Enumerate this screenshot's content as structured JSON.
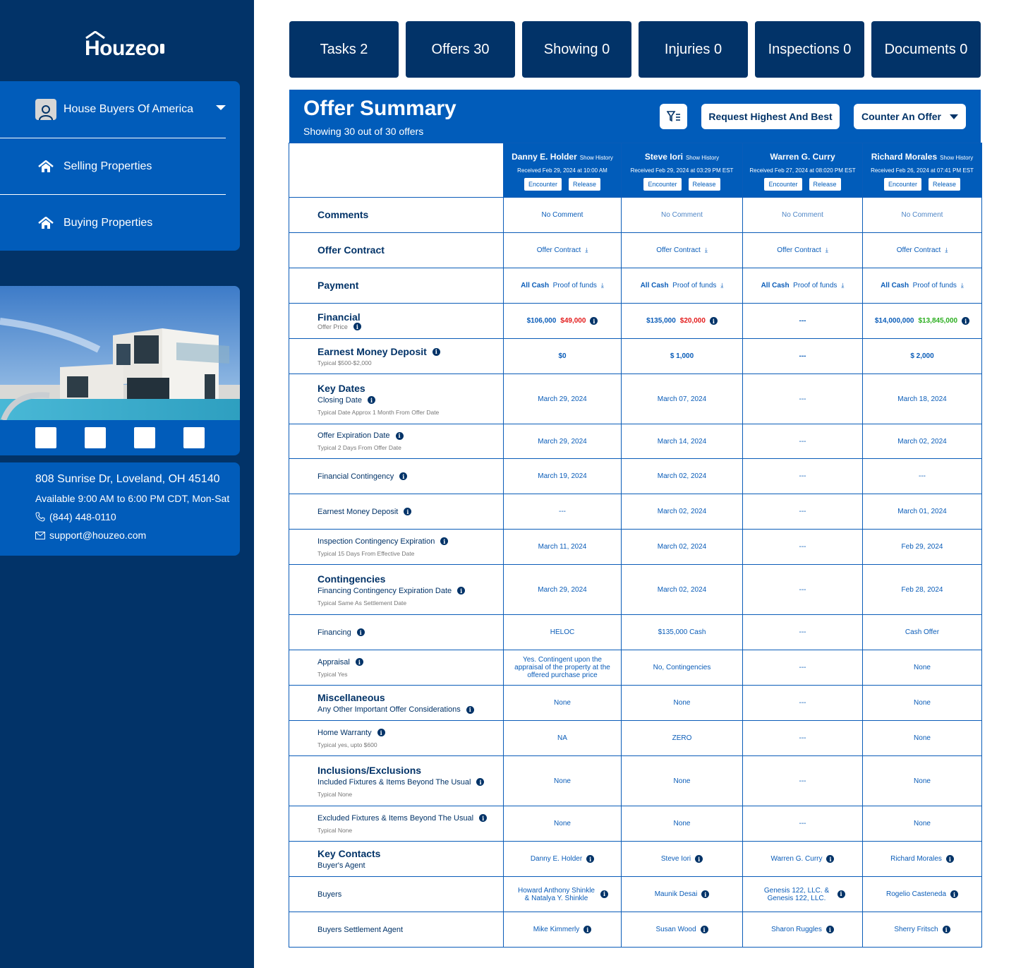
{
  "brand": {
    "name": "Houzeo"
  },
  "sidebar": {
    "account": {
      "name": "House Buyers Of America",
      "icon": "user-icon"
    },
    "nav": [
      {
        "label": "Selling Properties",
        "icon": "home-icon"
      },
      {
        "label": "Buying Properties",
        "icon": "home-icon"
      }
    ],
    "contact": {
      "address": "808 Sunrise Dr, Loveland, OH 45140",
      "hours": "Available 9:00 AM to 6:00 PM CDT, Mon-Sat",
      "phone": "(844) 448-0110",
      "email": "support@houzeo.com"
    }
  },
  "tabs": [
    {
      "label": "Tasks 2"
    },
    {
      "label": "Offers 30"
    },
    {
      "label": "Showing 0"
    },
    {
      "label": "Injuries 0"
    },
    {
      "label": "Inspections 0"
    },
    {
      "label": "Documents 0"
    }
  ],
  "summary": {
    "title": "Offer Summary",
    "subtitle": "Showing 30 out of 30 offers",
    "request_label": "Request Highest And Best",
    "counter_label": "Counter An Offer"
  },
  "colors": {
    "primary": "#015CBA",
    "dark": "#023368",
    "negative": "#E31B1B",
    "positive": "#2BAE1F"
  },
  "buyers": [
    {
      "name": "Danny E. Holder",
      "show_history": "Show History",
      "received": "Received Feb 29, 2024 at 10:00 AM",
      "encounter": "Encounter",
      "release": "Release"
    },
    {
      "name": "Steve Iori",
      "show_history": "Show History",
      "received": "Received Feb 29, 2024 at 03:29 PM EST",
      "encounter": "Encounter",
      "release": "Release"
    },
    {
      "name": "Warren G. Curry",
      "show_history": "",
      "received": "Received Feb 27, 2024 at 08:020 PM EST",
      "encounter": "Encounter",
      "release": "Release"
    },
    {
      "name": "Richard Morales",
      "show_history": "Show History",
      "received": "Received Feb 26, 2024 at 07:41 PM EST",
      "encounter": "Encounter",
      "release": "Release"
    }
  ],
  "rows": {
    "comments": {
      "title": "Comments",
      "values": [
        "No Comment",
        "No Comment",
        "No Comment",
        "No Comment"
      ]
    },
    "offer_contract": {
      "title": "Offer Contract",
      "values": [
        "Offer Contract",
        "Offer Contract",
        "Offer Contract",
        "Offer Contract"
      ]
    },
    "payment": {
      "title": "Payment",
      "type": [
        "All Cash",
        "All Cash",
        "All Cash",
        "All Cash"
      ],
      "link": [
        "Proof of funds",
        "Proof of funds",
        "Proof of funds",
        "Proof of funds"
      ]
    },
    "financial": {
      "title": "Financial",
      "sub": "Offer Price",
      "price": [
        "$106,000",
        "$135,000",
        "---",
        "$14,000,000"
      ],
      "diff": [
        "$49,000",
        "$20,000",
        "",
        "$13,845,000"
      ]
    },
    "emd": {
      "title": "Earnest Money Deposit",
      "hint": "Typical $500-$2,000",
      "values": [
        "$0",
        "$ 1,000",
        "---",
        "$ 2,000"
      ]
    },
    "closing": {
      "section": "Key Dates",
      "label": "Closing Date",
      "hint": "Typical Date Approx 1 Month From Offer Date",
      "values": [
        "March 29, 2024",
        "March 07, 2024",
        "---",
        "March 18, 2024"
      ]
    },
    "offer_exp": {
      "label": "Offer Expiration Date",
      "hint": "Typical 2 Days From Offer Date",
      "values": [
        "March 29, 2024",
        "March 14, 2024",
        "---",
        "March 02, 2024"
      ]
    },
    "fin_cont": {
      "label": "Financial Contingency",
      "values": [
        "March 19, 2024",
        "March 02, 2024",
        "---",
        "---"
      ]
    },
    "emd_date": {
      "label": "Earnest Money Deposit",
      "values": [
        "---",
        "March 02, 2024",
        "---",
        "March 01, 2024"
      ]
    },
    "insp_exp": {
      "label": "Inspection Contingency Expiration",
      "hint": "Typical 15 Days From Effective Date",
      "values": [
        "March 11, 2024",
        "March 02, 2024",
        "---",
        "Feb 29, 2024"
      ]
    },
    "fin_cont_exp": {
      "section": "Contingencies",
      "label": "Financing Contingency Expiration Date",
      "hint": "Typical Same As Settlement Date",
      "values": [
        "March 29, 2024",
        "March 02, 2024",
        "---",
        "Feb 28, 2024"
      ]
    },
    "financing": {
      "label": "Financing",
      "values": [
        "HELOC",
        "$135,000 Cash",
        "---",
        "Cash Offer"
      ]
    },
    "appraisal": {
      "label": "Appraisal",
      "hint": "Typical Yes",
      "values": [
        "Yes. Contingent upon the appraisal of the property at the offered purchase price",
        "No, Contingencies",
        "---",
        "None"
      ]
    },
    "misc": {
      "section": "Miscellaneous",
      "label": "Any Other Important Offer Considerations",
      "values": [
        "None",
        "None",
        "---",
        "None"
      ]
    },
    "warranty": {
      "label": "Home Warranty",
      "hint": "Typical yes, upto $600",
      "values": [
        "NA",
        "ZERO",
        "---",
        "None"
      ]
    },
    "included": {
      "section": "Inclusions/Exclusions",
      "label": "Included Fixtures & Items Beyond The Usual",
      "hint": "Typical None",
      "values": [
        "None",
        "None",
        "---",
        "None"
      ]
    },
    "excluded": {
      "label": "Excluded Fixtures & Items Beyond The Usual",
      "hint": "Typical None",
      "values": [
        "None",
        "None",
        "---",
        "None"
      ]
    },
    "agent": {
      "section": "Key Contacts",
      "label": "Buyer's Agent",
      "values": [
        "Danny E. Holder",
        "Steve Iori",
        "Warren G. Curry",
        "Richard Morales"
      ]
    },
    "buyers_row": {
      "label": "Buyers",
      "values": [
        "Howard Anthony Shinkle & Natalya Y. Shinkle",
        "Maunik Desai",
        "Genesis 122, LLC. & Genesis 122, LLC.",
        "Rogelio Casteneda"
      ]
    },
    "settlement": {
      "label": "Buyers Settlement Agent",
      "values": [
        "Mike Kimmerly",
        "Susan Wood",
        "Sharon Ruggles",
        "Sherry Fritsch"
      ]
    }
  }
}
